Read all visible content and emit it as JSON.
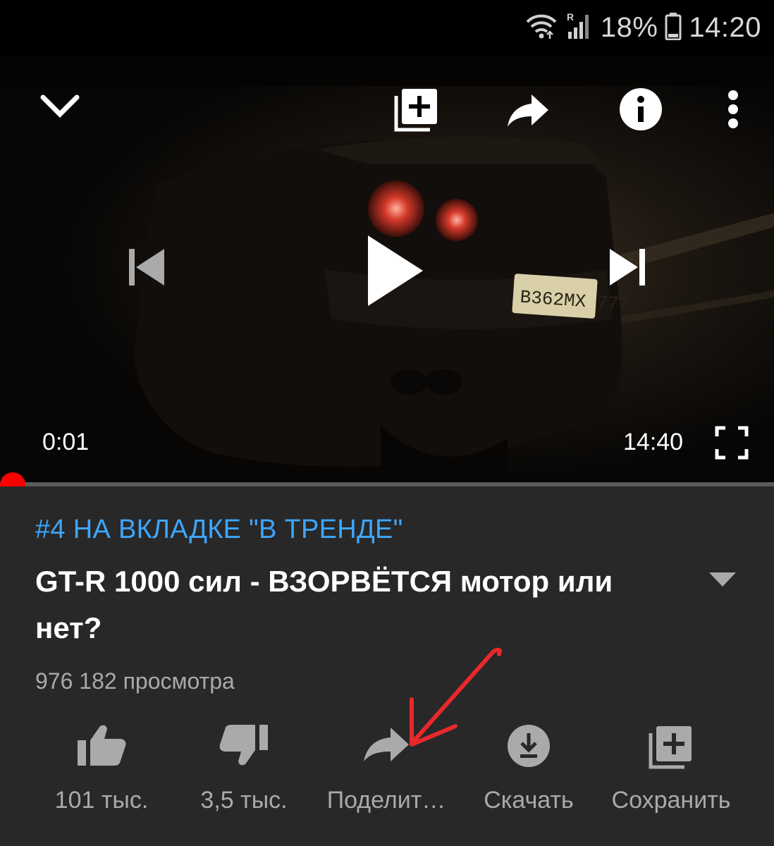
{
  "status_bar": {
    "battery_percent": "18%",
    "clock": "14:20",
    "icons": [
      "wifi-icon",
      "roaming-signal-icon",
      "battery-icon"
    ]
  },
  "player": {
    "current_time": "0:01",
    "duration": "14:40",
    "progress_fraction": 0.001,
    "plate_text": "B362MX 777",
    "controls": [
      "minimize-chevron-icon",
      "add-to-playlist-icon",
      "share-icon",
      "info-icon",
      "more-vert-icon",
      "previous-icon",
      "play-icon",
      "next-icon",
      "fullscreen-icon"
    ]
  },
  "video": {
    "trending_label": "#4 НА ВКЛАДКЕ \"В ТРЕНДЕ\"",
    "title": "GT-R 1000 сил - ВЗОРВЁТСЯ мотор или нет?",
    "views": "976 182 просмотра"
  },
  "actions": [
    {
      "label": "101 тыс.",
      "icon": "thumb-up-icon"
    },
    {
      "label": "3,5 тыс.",
      "icon": "thumb-down-icon"
    },
    {
      "label": "Поделит…",
      "icon": "share-icon"
    },
    {
      "label": "Скачать",
      "icon": "download-icon"
    },
    {
      "label": "Сохранить",
      "icon": "save-playlist-icon"
    }
  ],
  "colors": {
    "accent_red": "#ff0000",
    "trending_blue": "#3ea6ff",
    "panel_bg": "#282828",
    "secondary_text": "#aaaaaa",
    "annotation_arrow": "#e8282b"
  }
}
